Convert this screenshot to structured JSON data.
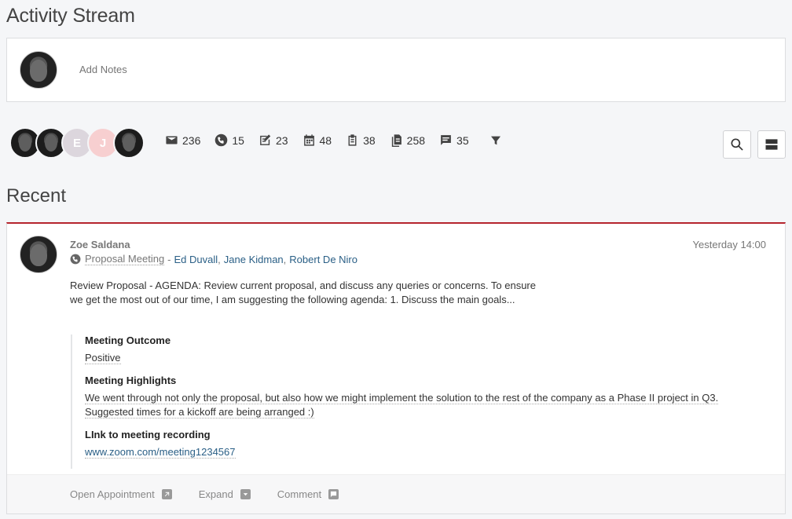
{
  "page": {
    "title": "Activity Stream"
  },
  "notes": {
    "placeholder": "Add Notes"
  },
  "filters": {
    "avatars": [
      {
        "type": "photo"
      },
      {
        "type": "photo"
      },
      {
        "type": "initial",
        "initial": "E"
      },
      {
        "type": "initial",
        "initial": "J"
      },
      {
        "type": "photo"
      }
    ],
    "counts": [
      {
        "icon": "email-icon",
        "value": "236"
      },
      {
        "icon": "phone-icon",
        "value": "15"
      },
      {
        "icon": "edit-note-icon",
        "value": "23"
      },
      {
        "icon": "calendar-icon",
        "value": "48"
      },
      {
        "icon": "clipboard-icon",
        "value": "38"
      },
      {
        "icon": "document-icon",
        "value": "258"
      },
      {
        "icon": "comment-icon",
        "value": "35"
      }
    ]
  },
  "recent": {
    "title": "Recent",
    "item": {
      "author": "Zoe Saldana",
      "timestamp": "Yesterday 14:00",
      "meeting_type": "Proposal Meeting",
      "separator": "-",
      "attendees": [
        "Ed Duvall",
        "Jane Kidman",
        "Robert De Niro"
      ],
      "body": "Review Proposal - AGENDA: Review current proposal, and discuss any queries or concerns. To ensure we get the most out of our time, I am suggesting the following agenda: 1. Discuss the main goals...",
      "outcome_label": "Meeting Outcome",
      "outcome_value": "Positive",
      "highlights_label": "Meeting Highlights",
      "highlights_value": "We went through not only the proposal, but also how we might implement the solution to the rest of the company as a Phase II project in Q3. Suggested times for a kickoff are being arranged :)",
      "link_label": "LInk to meeting recording",
      "link_value": "www.zoom.com/meeting1234567"
    },
    "footer": {
      "open_label": "Open Appointment",
      "expand_label": "Expand",
      "comment_label": "Comment"
    }
  }
}
